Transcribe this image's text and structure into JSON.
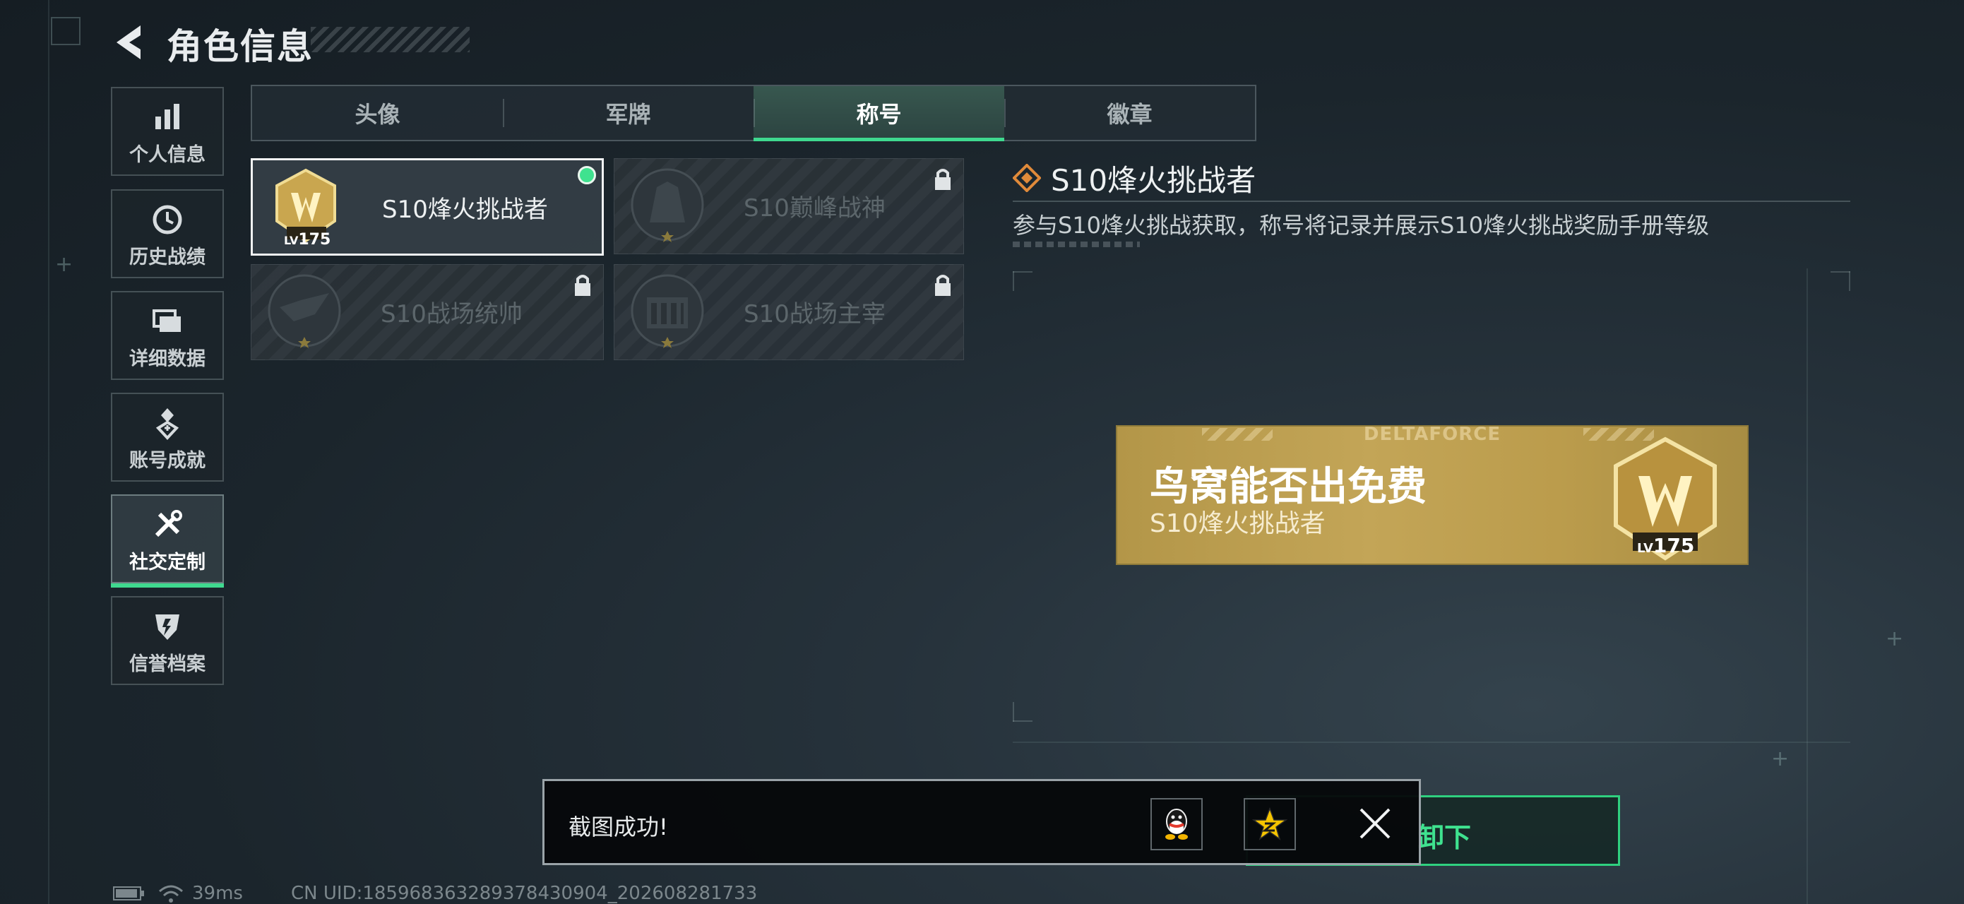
{
  "header": {
    "title": "角色信息"
  },
  "sidebar": {
    "items": [
      {
        "label": "个人信息",
        "icon": "bar-chart-icon"
      },
      {
        "label": "历史战绩",
        "icon": "clock-icon"
      },
      {
        "label": "详细数据",
        "icon": "folder-icon"
      },
      {
        "label": "账号成就",
        "icon": "achievement-icon"
      },
      {
        "label": "社交定制",
        "icon": "tools-icon",
        "active": true
      },
      {
        "label": "信誉档案",
        "icon": "shield-icon"
      }
    ]
  },
  "tabs": [
    {
      "label": "头像"
    },
    {
      "label": "军牌"
    },
    {
      "label": "称号",
      "active": true
    },
    {
      "label": "徽章"
    }
  ],
  "titles": [
    {
      "name": "S10烽火挑战者",
      "state": "equipped",
      "medal_level": "175",
      "medal_level_prefix": "LV"
    },
    {
      "name": "S10巅峰战神",
      "state": "locked"
    },
    {
      "name": "S10战场统帅",
      "state": "locked"
    },
    {
      "name": "S10战场主宰",
      "state": "locked"
    }
  ],
  "detail": {
    "title": "S10烽火挑战者",
    "description": "参与S10烽火挑战获取，称号将记录并展示S10烽火挑战奖励手册等级"
  },
  "banner": {
    "brand": "DELTAFORCE",
    "player_name": "鸟窝能否出免费",
    "title": "S10烽火挑战者",
    "level_prefix": "LV",
    "level": "175"
  },
  "actions": {
    "unequip_label": "卸下"
  },
  "toast": {
    "message": "截图成功!",
    "share_targets": [
      "qq-icon",
      "qzone-star-icon"
    ],
    "close_icon": "close-icon"
  },
  "status_bar": {
    "ping": "39ms",
    "uid": "CN UID:185968363289378430904_202608281733"
  },
  "colors": {
    "accent_green": "#3fd98f",
    "banner_gold": "#c3a557"
  }
}
